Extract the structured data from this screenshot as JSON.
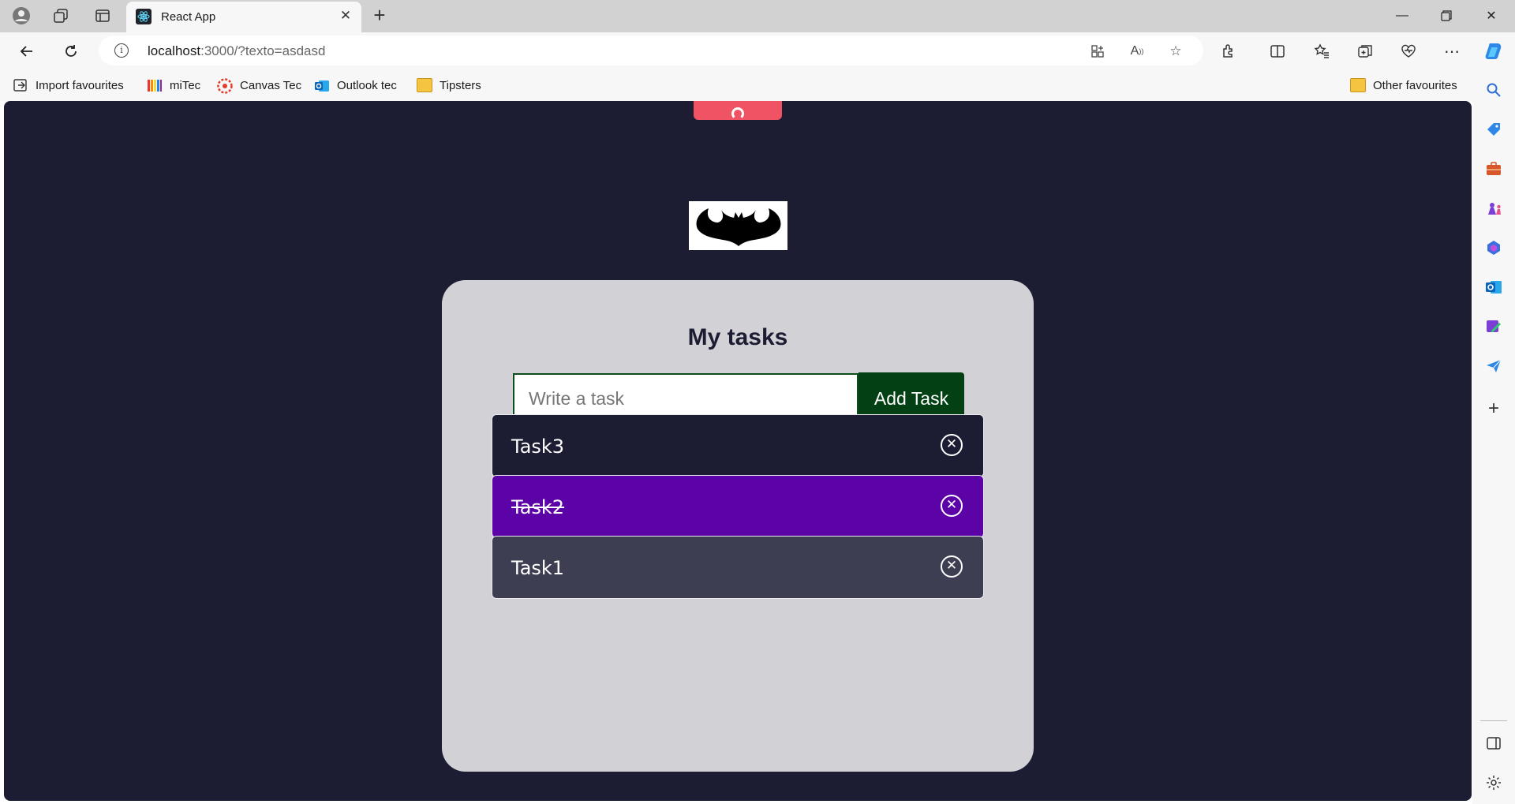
{
  "browser": {
    "tab": {
      "title": "React App"
    },
    "address": {
      "host": "localhost",
      "rest": ":3000/?texto=asdasd"
    },
    "favourites": [
      {
        "label": "Import favourites",
        "icon": "import-icon"
      },
      {
        "label": "miTec",
        "icon": "mitec-icon"
      },
      {
        "label": "Canvas Tec",
        "icon": "canvas-icon"
      },
      {
        "label": "Outlook tec",
        "icon": "outlook-icon"
      },
      {
        "label": "Tipsters",
        "icon": "folder-icon"
      }
    ],
    "other_favourites": "Other favourites"
  },
  "app": {
    "title": "My tasks",
    "input": {
      "placeholder": "Write a task",
      "value": ""
    },
    "add_button": "Add Task",
    "tasks": [
      {
        "text": "Task3",
        "completed": false,
        "color": "#1c1d33"
      },
      {
        "text": "Task2",
        "completed": true,
        "color": "#5c03a8"
      },
      {
        "text": "Task1",
        "completed": false,
        "color": "#3d3e52"
      }
    ]
  },
  "colors": {
    "page_bg": "#1c1d33",
    "card_bg": "#d2d2d6",
    "accent_green": "#034115",
    "pull_tab": "#f05364"
  }
}
